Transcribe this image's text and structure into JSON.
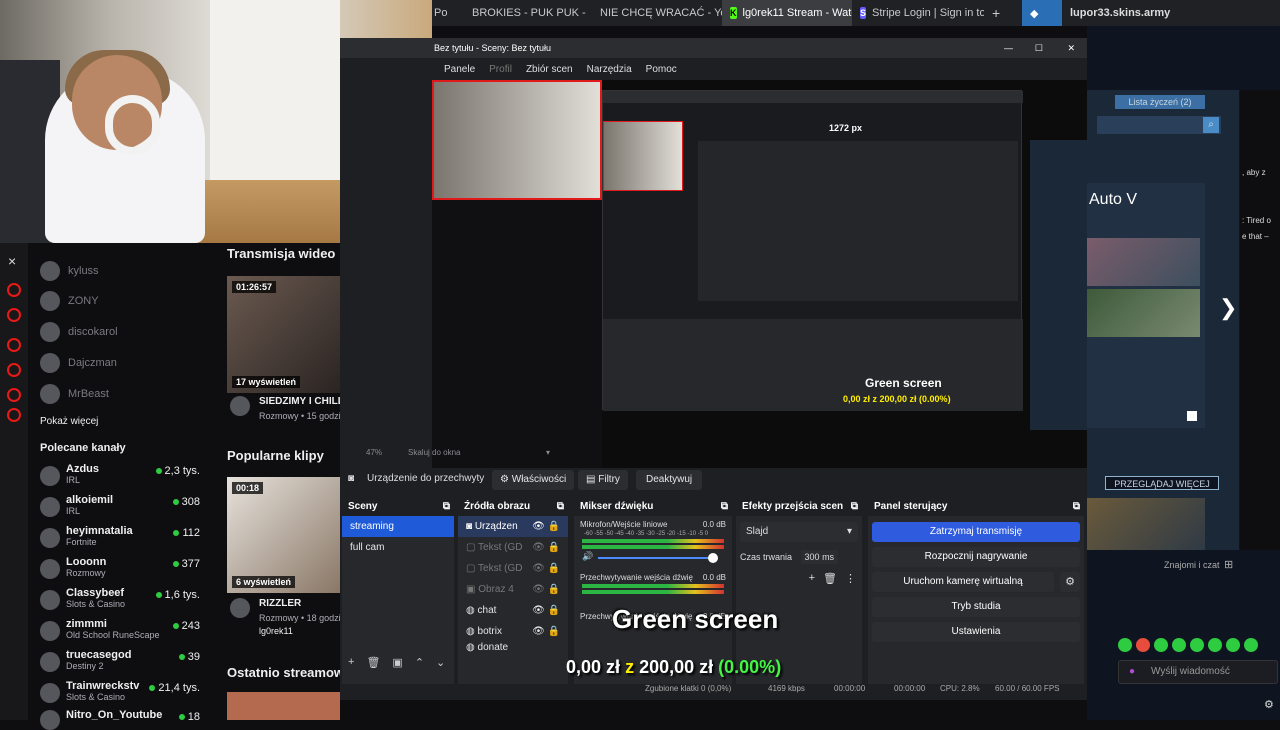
{
  "browser": {
    "tabs": [
      {
        "icon": "youtube-icon",
        "label": "BROKIES - PUK PUK - Yo"
      },
      {
        "icon": "youtube-icon",
        "label": "NIE CHCĘ WRACAĆ - Yo"
      },
      {
        "icon": "kick-icon",
        "label": "lg0rek11 Stream - Watch"
      },
      {
        "icon": "stripe-icon",
        "label": "Stripe Login | Sign in to th"
      }
    ],
    "partial_tab": "Po",
    "right_site_title": "lupor33.skins.army"
  },
  "twitch": {
    "close_label": "×",
    "mini_channels": [
      "kyluss",
      "ZONY",
      "discokarol",
      "Dajczman",
      "MrBeast"
    ],
    "show_more": "Pokaż więcej",
    "recommended_title": "Polecane kanały",
    "recommended": [
      {
        "name": "Azdus",
        "category": "IRL",
        "viewers": "2,3 tys."
      },
      {
        "name": "alkoiemil",
        "category": "IRL",
        "viewers": "308"
      },
      {
        "name": "heyimnatalia",
        "category": "Fortnite",
        "viewers": "112"
      },
      {
        "name": "Looonn",
        "category": "Rozmowy",
        "viewers": "377"
      },
      {
        "name": "Classybeef",
        "category": "Slots & Casino",
        "viewers": "1,6 tys."
      },
      {
        "name": "zimmmi",
        "category": "Old School RuneScape",
        "viewers": "243"
      },
      {
        "name": "truecasegod",
        "category": "Destiny 2",
        "viewers": "39"
      },
      {
        "name": "Trainwreckstv",
        "category": "Slots & Casino",
        "viewers": "21,4 tys."
      },
      {
        "name": "Nitro_On_Youtube",
        "category": "",
        "viewers": "18"
      }
    ],
    "videos_title": "Transmisja wideo",
    "video": {
      "duration": "01:26:57",
      "views": "17 wyświetleń",
      "title": "SIEDZIMY I CHILL",
      "meta": "Rozmowy • 15 godzi"
    },
    "clips_title": "Popularne klipy",
    "clip": {
      "duration": "00:18",
      "views": "6 wyświetleń",
      "title": "RIZZLER",
      "meta": "Rozmowy • 18 godzi",
      "author": "lg0rek11"
    },
    "recent_title": "Ostatnio streamow"
  },
  "obs": {
    "window_title": "Bez tytułu - Sceny: Bez tytułu",
    "menu": [
      "Panele",
      "Profil",
      "Zbiór scen",
      "Narzędzia",
      "Pomoc"
    ],
    "zoom": "47%",
    "scale_label": "Skaluj do okna",
    "source_toolbar": {
      "device": "Urządzenie do przechwyty",
      "properties": "Właściwości",
      "filters": "Filtry",
      "deactivate": "Deaktywuj"
    },
    "scenes": {
      "title": "Sceny",
      "items": [
        "streaming",
        "full cam"
      ]
    },
    "sources": {
      "title": "Źródła obrazu",
      "items": [
        "Urządzen",
        "Tekst (GD",
        "Tekst (GD",
        "Obraz 4",
        "chat",
        "botrix",
        "donate"
      ]
    },
    "mixer": {
      "title": "Mikser dźwięku",
      "channels": [
        {
          "name": "Mikrofon/Wejście liniowe",
          "db": "0.0 dB"
        },
        {
          "name": "Przechwytywanie wejścia dźwię",
          "db": "0.0 dB"
        },
        {
          "name": "Przechwytywanie wyjścia dźwię",
          "db": "0.0 dB"
        }
      ],
      "scale": "-60 -55 -50 -45 -40 -35 -30 -25 -20 -15 -10 -5 0"
    },
    "transitions": {
      "title": "Efekty przejścia scen",
      "type": "Slajd",
      "duration_label": "Czas trwania",
      "duration": "300 ms"
    },
    "controls": {
      "title": "Panel sterujący",
      "buttons": [
        "Zatrzymaj transmisję",
        "Rozpocznij nagrywanie",
        "Uruchom kamerę wirtualną",
        "Tryb studia",
        "Ustawienia"
      ]
    },
    "status": {
      "dropped": "Zgubione klatki 0 (0,0%)",
      "bitrate": "4169 kbps",
      "stream_time": "00:00:00",
      "rec_time": "00:00:00",
      "cpu": "CPU: 2.8%",
      "fps": "60.00 / 60.00 FPS"
    },
    "preview_text": {
      "px_label": "1272 px",
      "green": "Green screen",
      "amount": "0,00 zł z 200,00 zł (0.00%)"
    }
  },
  "overlay": {
    "title": "Green screen",
    "amount_current": "0,00 zł",
    "amount_sep": "z",
    "amount_goal": "200,00 zł",
    "amount_pct": "(0.00%)"
  },
  "right_site": {
    "wishlist": "Lista życzeń (2)",
    "game_title": "Auto V",
    "browse_more": "PRZEGLĄDAJ WIĘCEJ",
    "chat_header": "Znajomi i czat",
    "message_placeholder": "Wyślij wiadomość",
    "side_text": [
      ", aby z",
      ": Tired o",
      "e that –"
    ]
  }
}
